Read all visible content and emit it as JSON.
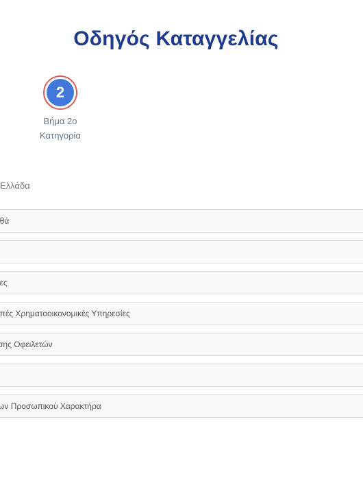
{
  "header": {
    "title": "Οδηγός Καταγγελίας"
  },
  "step": {
    "number": "2",
    "label_line1": "Βήμα 2ο",
    "label_line2": "Κατηγορία",
    "circle_color": "#3f78d9",
    "ring_color": "#e05a5a"
  },
  "country": {
    "text": "Ελλάδα"
  },
  "categories": [
    "ιθά",
    "",
    "ιες",
    "ιπές Χρηματοοικονομικές Υπηρεσίες",
    "σης Οφειλετών",
    "",
    "ων Προσωπικού Χαρακτήρα"
  ],
  "colors": {
    "title": "#1d3a8f",
    "row_border": "#d9d9d9",
    "row_background": "#fafafa"
  }
}
